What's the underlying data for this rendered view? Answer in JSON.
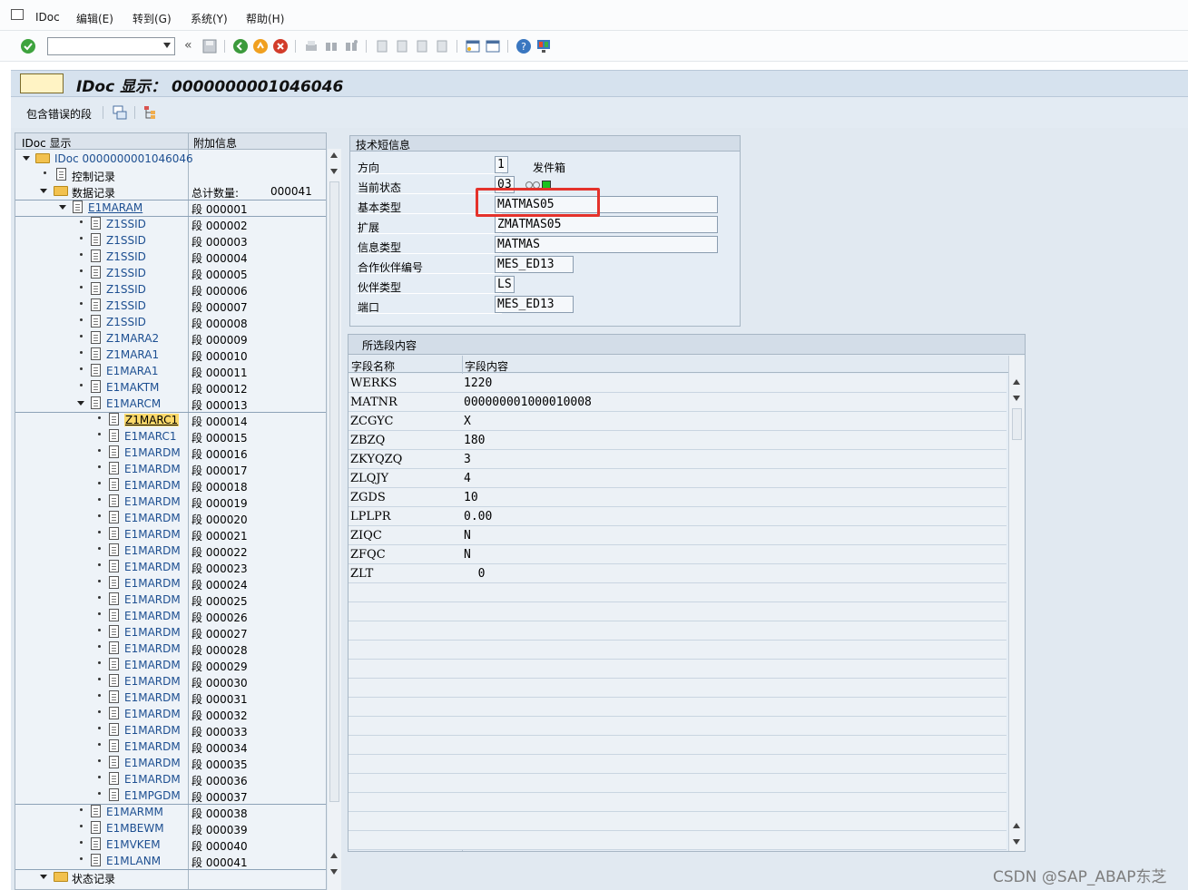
{
  "menu": {
    "items": [
      "IDoc",
      "编辑(E)",
      "转到(G)",
      "系统(Y)",
      "帮助(H)"
    ]
  },
  "toolbar": {
    "command_value": "",
    "icons": [
      "check-icon",
      "back-icon",
      "save-icon",
      "nav-back-icon",
      "exit-icon",
      "cancel-icon",
      "print-icon",
      "find-icon",
      "find-next-icon",
      "first-page-icon",
      "prev-page-icon",
      "next-page-icon",
      "last-page-icon",
      "create-session-icon",
      "shortcut-icon",
      "help-icon",
      "layout-icon"
    ]
  },
  "title": {
    "text": "IDoc 显示： 0000000001046046"
  },
  "app_toolbar": {
    "label": "包含错误的段"
  },
  "tree": {
    "headers": [
      "IDoc 显示",
      "附加信息"
    ],
    "root": "IDoc 0000000001046046",
    "control": "控制记录",
    "data": "数据记录",
    "total_label": "总计数量:",
    "total_value": "000041",
    "status": "状态记录",
    "segments": [
      {
        "name": "E1MARAM",
        "seg": "段 000001"
      },
      {
        "name": "Z1SSID",
        "seg": "段 000002"
      },
      {
        "name": "Z1SSID",
        "seg": "段 000003"
      },
      {
        "name": "Z1SSID",
        "seg": "段 000004"
      },
      {
        "name": "Z1SSID",
        "seg": "段 000005"
      },
      {
        "name": "Z1SSID",
        "seg": "段 000006"
      },
      {
        "name": "Z1SSID",
        "seg": "段 000007"
      },
      {
        "name": "Z1SSID",
        "seg": "段 000008"
      },
      {
        "name": "Z1MARA2",
        "seg": "段 000009"
      },
      {
        "name": "Z1MARA1",
        "seg": "段 000010"
      },
      {
        "name": "E1MARA1",
        "seg": "段 000011"
      },
      {
        "name": "E1MAKTM",
        "seg": "段 000012"
      },
      {
        "name": "E1MARCM",
        "seg": "段 000013"
      },
      {
        "name": "Z1MARC1",
        "seg": "段 000014"
      },
      {
        "name": "E1MARC1",
        "seg": "段 000015"
      },
      {
        "name": "E1MARDM",
        "seg": "段 000016"
      },
      {
        "name": "E1MARDM",
        "seg": "段 000017"
      },
      {
        "name": "E1MARDM",
        "seg": "段 000018"
      },
      {
        "name": "E1MARDM",
        "seg": "段 000019"
      },
      {
        "name": "E1MARDM",
        "seg": "段 000020"
      },
      {
        "name": "E1MARDM",
        "seg": "段 000021"
      },
      {
        "name": "E1MARDM",
        "seg": "段 000022"
      },
      {
        "name": "E1MARDM",
        "seg": "段 000023"
      },
      {
        "name": "E1MARDM",
        "seg": "段 000024"
      },
      {
        "name": "E1MARDM",
        "seg": "段 000025"
      },
      {
        "name": "E1MARDM",
        "seg": "段 000026"
      },
      {
        "name": "E1MARDM",
        "seg": "段 000027"
      },
      {
        "name": "E1MARDM",
        "seg": "段 000028"
      },
      {
        "name": "E1MARDM",
        "seg": "段 000029"
      },
      {
        "name": "E1MARDM",
        "seg": "段 000030"
      },
      {
        "name": "E1MARDM",
        "seg": "段 000031"
      },
      {
        "name": "E1MARDM",
        "seg": "段 000032"
      },
      {
        "name": "E1MARDM",
        "seg": "段 000033"
      },
      {
        "name": "E1MARDM",
        "seg": "段 000034"
      },
      {
        "name": "E1MARDM",
        "seg": "段 000035"
      },
      {
        "name": "E1MARDM",
        "seg": "段 000036"
      },
      {
        "name": "E1MPGDM",
        "seg": "段 000037"
      },
      {
        "name": "E1MARMM",
        "seg": "段 000038"
      },
      {
        "name": "E1MBEWM",
        "seg": "段 000039"
      },
      {
        "name": "E1MVKEM",
        "seg": "段 000040"
      },
      {
        "name": "E1MLANM",
        "seg": "段 000041"
      }
    ],
    "selected_segment": "Z1MARC1"
  },
  "tech": {
    "header": "技术短信息",
    "direction_label": "方向",
    "direction_value": "1",
    "direction_text": "发件箱",
    "status_label": "当前状态",
    "status_value": "03",
    "status_color": "#19c21f",
    "basic_type_label": "基本类型",
    "basic_type_value": "MATMAS05",
    "extension_label": "扩展",
    "extension_value": "ZMATMAS05",
    "message_type_label": "信息类型",
    "message_type_value": "MATMAS",
    "partner_no_label": "合作伙伴编号",
    "partner_no_value": "MES_ED13",
    "partner_type_label": "伙伴类型",
    "partner_type_value": "LS",
    "port_label": "端口",
    "port_value": "MES_ED13"
  },
  "segment_content": {
    "header": "所选段内容",
    "col_name": "字段名称",
    "col_value": "字段内容",
    "rows": [
      {
        "name": "WERKS",
        "value": "1220"
      },
      {
        "name": "MATNR",
        "value": "000000001000010008"
      },
      {
        "name": "ZCGYC",
        "value": "X"
      },
      {
        "name": "ZBZQ",
        "value": "180"
      },
      {
        "name": "ZKYQZQ",
        "value": "3"
      },
      {
        "name": "ZLQJY",
        "value": "4"
      },
      {
        "name": "ZGDS",
        "value": "10"
      },
      {
        "name": "LPLPR",
        "value": "0.00"
      },
      {
        "name": "ZIQC",
        "value": "N"
      },
      {
        "name": "ZFQC",
        "value": "N"
      },
      {
        "name": "ZLT",
        "value": "  0"
      }
    ]
  },
  "watermark": "CSDN @SAP_ABAP东芝",
  "colors": {
    "highlight": "#e4322b",
    "link": "#1d4f91"
  }
}
